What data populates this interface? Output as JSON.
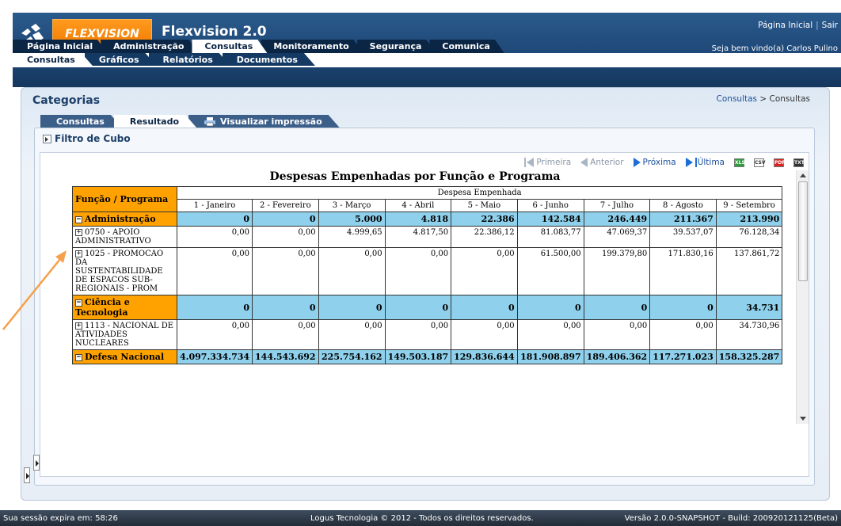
{
  "header": {
    "brand": "FLEXVISION",
    "app_title": "Flexvision 2.0",
    "link_home": "Página Inicial",
    "link_sep": "|",
    "link_exit": "Sair",
    "welcome": "Seja bem vindo(a) Carlos Pulino"
  },
  "main_tabs": [
    "Página Inicial",
    "Administração",
    "Consultas",
    "Monitoramento",
    "Segurança",
    "Comunica"
  ],
  "sub_tabs": [
    "Consultas",
    "Gráficos",
    "Relatórios",
    "Documentos"
  ],
  "panel": {
    "title": "Categorias",
    "breadcrumb_link": "Consultas",
    "breadcrumb_sep": ">",
    "breadcrumb_current": "Consultas",
    "inner_tabs": [
      "Consultas",
      "Resultado",
      "Visualizar impressão"
    ],
    "filter_label": "Filtro de Cubo"
  },
  "pager": {
    "first": "Primeira",
    "prev": "Anterior",
    "next": "Próxima",
    "last": "Última",
    "exports": [
      "XLS",
      "CSV",
      "PDF",
      "TXT"
    ]
  },
  "report": {
    "title": "Despesas Empenhadas por Função e Programa",
    "row_header": "Função / Programa",
    "group_header": "Despesa Empenhada",
    "months": [
      "1 - Janeiro",
      "2 - Fevereiro",
      "3 - Março",
      "4 - Abril",
      "5 - Maio",
      "6 - Junho",
      "7 - Julho",
      "8 - Agosto",
      "9 - Setembro"
    ],
    "rows": [
      {
        "type": "func",
        "label": "Administração",
        "values": [
          "0",
          "0",
          "5.000",
          "4.818",
          "22.386",
          "142.584",
          "246.449",
          "211.367",
          "213.990"
        ]
      },
      {
        "type": "prog",
        "label": "0750 - APOIO ADMINISTRATIVO",
        "values": [
          "0,00",
          "0,00",
          "4.999,65",
          "4.817,50",
          "22.386,12",
          "81.083,77",
          "47.069,37",
          "39.537,07",
          "76.128,34"
        ]
      },
      {
        "type": "prog",
        "label": "1025 - PROMOCAO DA SUSTENTABILIDADE DE ESPACOS SUB-REGIONAIS - PROM",
        "values": [
          "0,00",
          "0,00",
          "0,00",
          "0,00",
          "0,00",
          "61.500,00",
          "199.379,80",
          "171.830,16",
          "137.861,72"
        ]
      },
      {
        "type": "func",
        "label": "Ciência e Tecnologia",
        "values": [
          "0",
          "0",
          "0",
          "0",
          "0",
          "0",
          "0",
          "0",
          "34.731"
        ]
      },
      {
        "type": "prog",
        "label": "1113 - NACIONAL DE ATIVIDADES NUCLEARES",
        "values": [
          "0,00",
          "0,00",
          "0,00",
          "0,00",
          "0,00",
          "0,00",
          "0,00",
          "0,00",
          "34.730,96"
        ]
      },
      {
        "type": "func",
        "label": "Defesa Nacional",
        "values": [
          "4.097.334.734",
          "144.543.692",
          "225.754.162",
          "149.503.187",
          "129.836.644",
          "181.908.897",
          "189.406.362",
          "117.271.023",
          "158.325.287"
        ]
      }
    ]
  },
  "footer": {
    "session": "Sua sessão expira em: 58:26",
    "copyright": "Logus Tecnologia © 2012 - Todos os direitos reservados.",
    "version": "Versão 2.0.0-SNAPSHOT - Build: 200920121125(Beta)"
  },
  "colors": {
    "header_blue": "#1d4675",
    "brand_orange": "#f07a00",
    "function_row": "#ffa200",
    "value_cyan": "#8fd1ec",
    "annotation_arrow": "#f5a04a"
  }
}
